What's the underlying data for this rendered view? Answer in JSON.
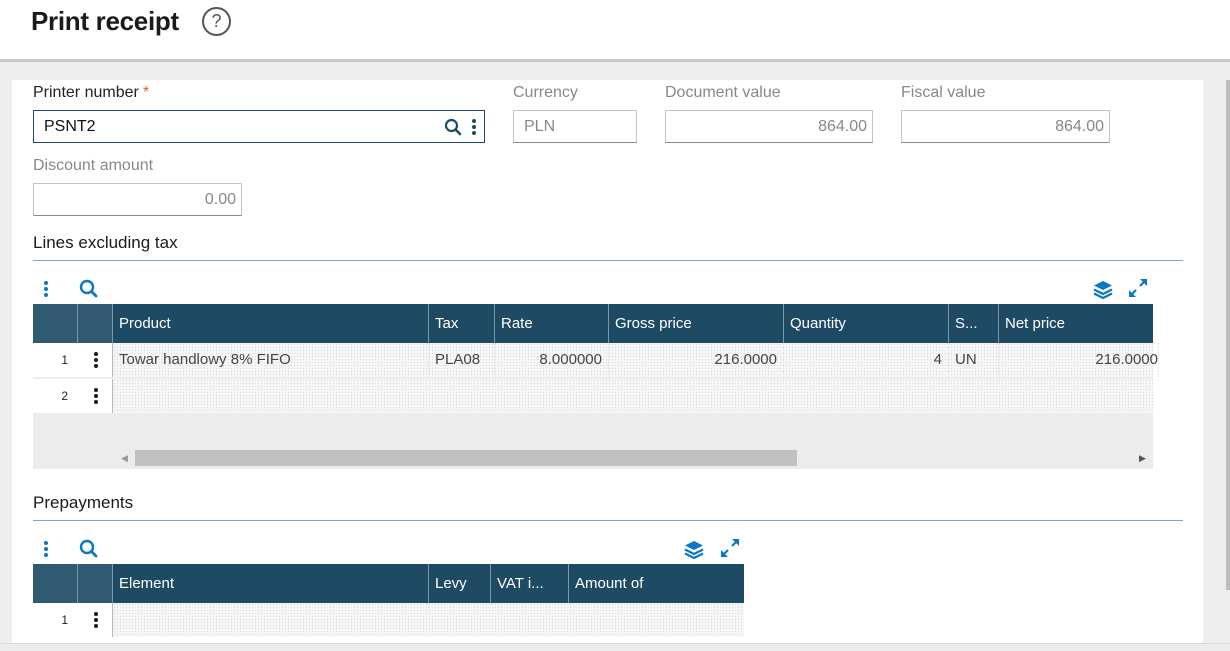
{
  "page": {
    "title": "Print receipt",
    "help_icon": "question-circle-icon"
  },
  "fields": {
    "printer_number": {
      "label": "Printer number",
      "required_mark": "*",
      "value": "PSNT2"
    },
    "currency": {
      "label": "Currency",
      "value": "PLN"
    },
    "document_value": {
      "label": "Document value",
      "value": "864.00"
    },
    "fiscal_value": {
      "label": "Fiscal value",
      "value": "864.00"
    },
    "discount_amount": {
      "label": "Discount amount",
      "value": "0.00"
    }
  },
  "lines_grid": {
    "title": "Lines excluding tax",
    "columns": [
      "Product",
      "Tax",
      "Rate",
      "Gross price",
      "Quantity",
      "S...",
      "Net price"
    ],
    "rows": [
      {
        "num": "1",
        "cells": [
          "Towar handlowy 8% FIFO",
          "PLA08",
          "8.000000",
          "216.0000",
          "4",
          "UN",
          "216.0000"
        ]
      },
      {
        "num": "2",
        "cells": [
          "",
          "",
          "",
          "",
          "",
          "",
          ""
        ]
      }
    ]
  },
  "prepayments_grid": {
    "title": "Prepayments",
    "columns": [
      "Element",
      "Levy",
      "VAT i...",
      "Amount of"
    ],
    "rows": [
      {
        "num": "1",
        "cells": [
          "",
          "",
          "",
          ""
        ]
      }
    ]
  },
  "colors": {
    "grid_header": "#1e4b63",
    "accent": "#0a78c2",
    "required": "#e8601c"
  }
}
